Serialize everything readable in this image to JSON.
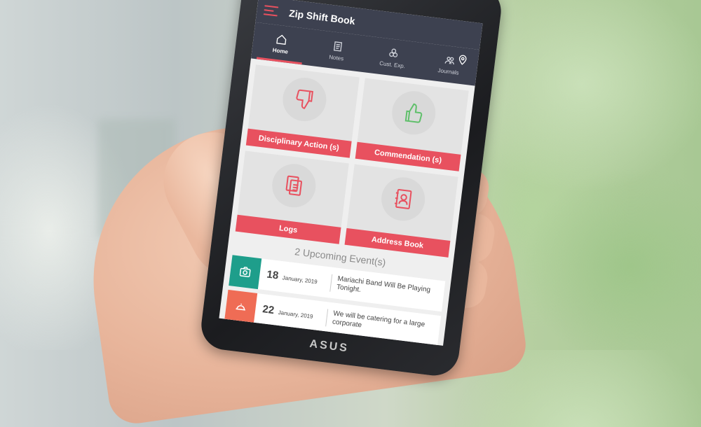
{
  "app": {
    "title": "Zip Shift Book"
  },
  "tabs": [
    {
      "label": "Home",
      "icon": "home-icon",
      "active": true
    },
    {
      "label": "Notes",
      "icon": "notes-icon",
      "active": false
    },
    {
      "label": "Cust. Exp.",
      "icon": "customer-experience-icon",
      "active": false
    },
    {
      "label": "Journals",
      "icon": "journals-icon",
      "active": false
    }
  ],
  "cards": [
    {
      "label": "Disciplinary Action (s)",
      "icon": "thumbs-down-icon"
    },
    {
      "label": "Commendation (s)",
      "icon": "thumbs-up-icon"
    },
    {
      "label": "Logs",
      "icon": "documents-icon"
    },
    {
      "label": "Address Book",
      "icon": "address-book-icon"
    }
  ],
  "events": {
    "title": "2 Upcoming Event(s)",
    "items": [
      {
        "day": "18",
        "month_year": "January, 2019",
        "text": "Mariachi Band Will Be Playing Tonight.",
        "color": "#1e9e8b",
        "icon": "camera-icon"
      },
      {
        "day": "22",
        "month_year": "January, 2019",
        "text": "We will be catering for a large corporate",
        "color": "#ef6c55",
        "icon": "food-tray-icon"
      }
    ]
  },
  "device": {
    "brand": "ASUS"
  },
  "colors": {
    "accent": "#e8515f",
    "appbar": "#3d4150",
    "teal": "#1e9e8b",
    "orange": "#ef6c55"
  }
}
